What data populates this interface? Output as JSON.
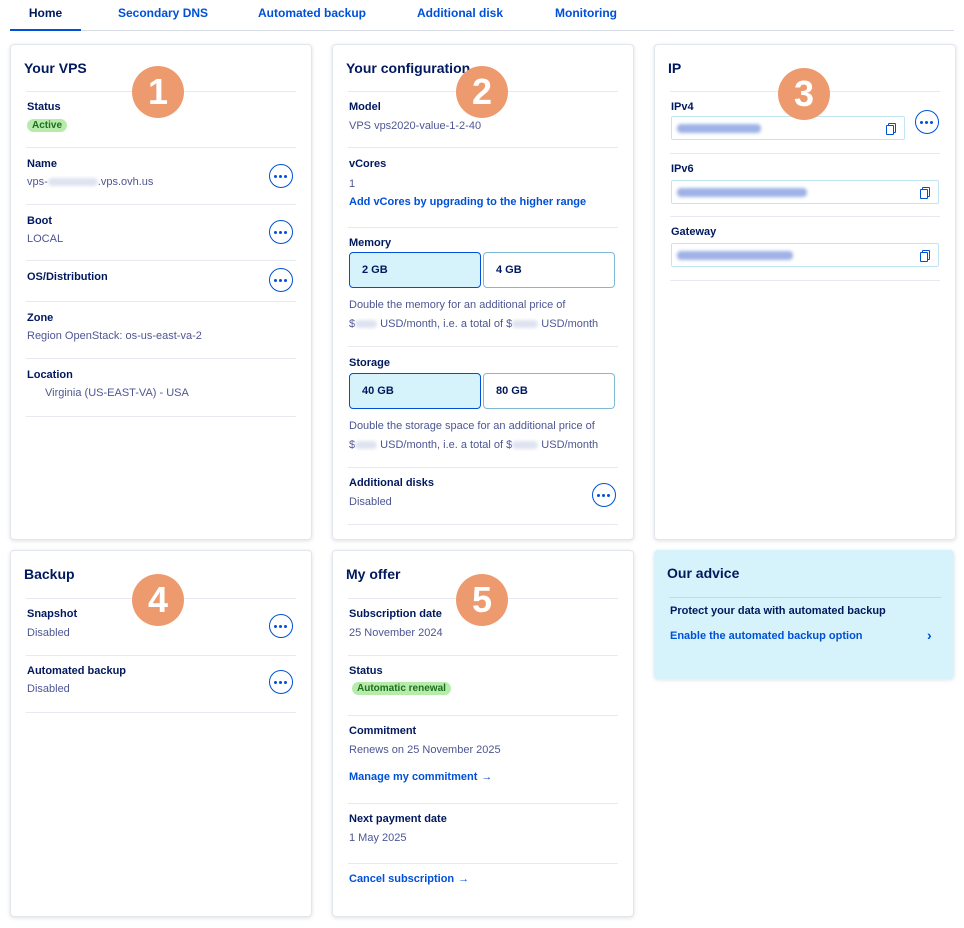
{
  "tabs": [
    "Home",
    "Secondary DNS",
    "Automated backup",
    "Additional disk",
    "Monitoring"
  ],
  "markers": [
    "1",
    "2",
    "3",
    "4",
    "5"
  ],
  "accent_color": "#0050d7",
  "marker_color": "#ee9a6f",
  "vps": {
    "title": "Your VPS",
    "status_label": "Status",
    "status_value": "Active",
    "name_label": "Name",
    "name_prefix": "vps-",
    "name_suffix": ".vps.ovh.us",
    "boot_label": "Boot",
    "boot_value": "LOCAL",
    "os_label": "OS/Distribution",
    "zone_label": "Zone",
    "zone_value": "Region OpenStack: os-us-east-va-2",
    "location_label": "Location",
    "location_value": "Virginia (US-EAST-VA) - USA"
  },
  "config": {
    "title": "Your configuration",
    "model_label": "Model",
    "model_value": "VPS vps2020-value-1-2-40",
    "vcores_label": "vCores",
    "vcores_value": "1",
    "vcores_link": "Add vCores by upgrading to the higher range",
    "memory_label": "Memory",
    "memory_options": [
      "2 GB",
      "4 GB"
    ],
    "memory_note_1": "Double the memory for an additional price of",
    "memory_note_2a": "$",
    "memory_note_2b": " USD/month, i.e. a total of $",
    "memory_note_2c": " USD/month",
    "storage_label": "Storage",
    "storage_options": [
      "40 GB",
      "80 GB"
    ],
    "storage_note_1": "Double the storage space for an additional price of",
    "storage_note_2a": "$",
    "storage_note_2b": " USD/month, i.e. a total of $",
    "storage_note_2c": " USD/month",
    "disks_label": "Additional disks",
    "disks_value": "Disabled"
  },
  "ip": {
    "title": "IP",
    "ipv4_label": "IPv4",
    "ipv6_label": "IPv6",
    "gateway_label": "Gateway"
  },
  "backup": {
    "title": "Backup",
    "snapshot_label": "Snapshot",
    "snapshot_value": "Disabled",
    "auto_label": "Automated backup",
    "auto_value": "Disabled"
  },
  "offer": {
    "title": "My offer",
    "sub_date_label": "Subscription date",
    "sub_date_value": "25 November 2024",
    "status_label": "Status",
    "status_value": "Automatic renewal",
    "commitment_label": "Commitment",
    "commitment_value": "Renews on 25 November 2025",
    "manage_link": "Manage my commitment",
    "next_payment_label": "Next payment date",
    "next_payment_value": "1 May 2025",
    "cancel_link": "Cancel subscription",
    "link_arrow": "→"
  },
  "advice": {
    "title": "Our advice",
    "text": "Protect your data with automated backup",
    "link": "Enable the automated backup option",
    "chevron": "›"
  }
}
